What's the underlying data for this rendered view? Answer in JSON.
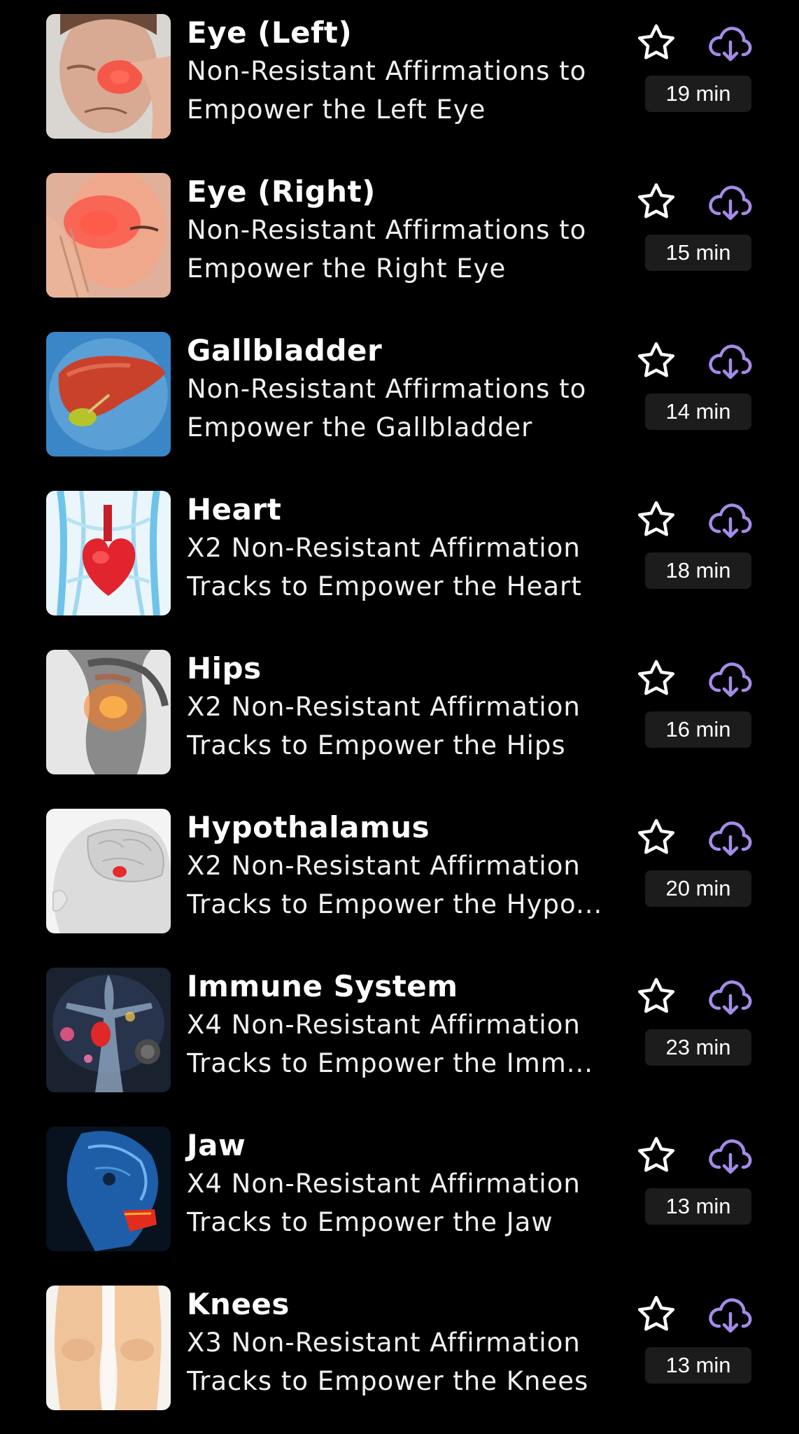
{
  "colors": {
    "background": "#000000",
    "accent": "#a58be8",
    "badge_background": "#1c1c1c",
    "text": "#ffffff"
  },
  "icons": {
    "favorite": "star-outline-icon",
    "download": "cloud-download-icon"
  },
  "tracks": [
    {
      "title": "Eye (Left)",
      "description_line1": "Non-Resistant Affirmations to",
      "description_line2": "Empower the Left Eye",
      "duration": "19 min",
      "thumbnail": "face-pressing-left-eye"
    },
    {
      "title": "Eye (Right)",
      "description_line1": "Non-Resistant Affirmations to",
      "description_line2": "Empower the Right Eye",
      "duration": "15 min",
      "thumbnail": "face-pressing-right-eye"
    },
    {
      "title": "Gallbladder",
      "description_line1": "Non-Resistant Affirmations to",
      "description_line2": "Empower the Gallbladder",
      "duration": "14 min",
      "thumbnail": "liver-and-gallbladder"
    },
    {
      "title": "Heart",
      "description_line1": "X2 Non-Resistant Affirmation",
      "description_line2": "Tracks to Empower the Heart",
      "duration": "18 min",
      "thumbnail": "heart-anatomy"
    },
    {
      "title": "Hips",
      "description_line1": "X2 Non-Resistant Affirmation",
      "description_line2": "Tracks to Empower the Hips",
      "duration": "16 min",
      "thumbnail": "hip-pain"
    },
    {
      "title": "Hypothalamus",
      "description_line1": "X2 Non-Resistant Affirmation",
      "description_line2": "Tracks to Empower the Hypo...",
      "duration": "20 min",
      "thumbnail": "brain-hypothalamus"
    },
    {
      "title": "Immune System",
      "description_line1": "X4 Non-Resistant Affirmation",
      "description_line2": "Tracks to Empower the Imm...",
      "duration": "23 min",
      "thumbnail": "immune-system"
    },
    {
      "title": "Jaw",
      "description_line1": "X4 Non-Resistant Affirmation",
      "description_line2": "Tracks to Empower the Jaw",
      "duration": "13 min",
      "thumbnail": "xray-skull-jaw"
    },
    {
      "title": "Knees",
      "description_line1": "X3 Non-Resistant Affirmation",
      "description_line2": "Tracks to Empower the Knees",
      "duration": "13 min",
      "thumbnail": "knees"
    }
  ]
}
